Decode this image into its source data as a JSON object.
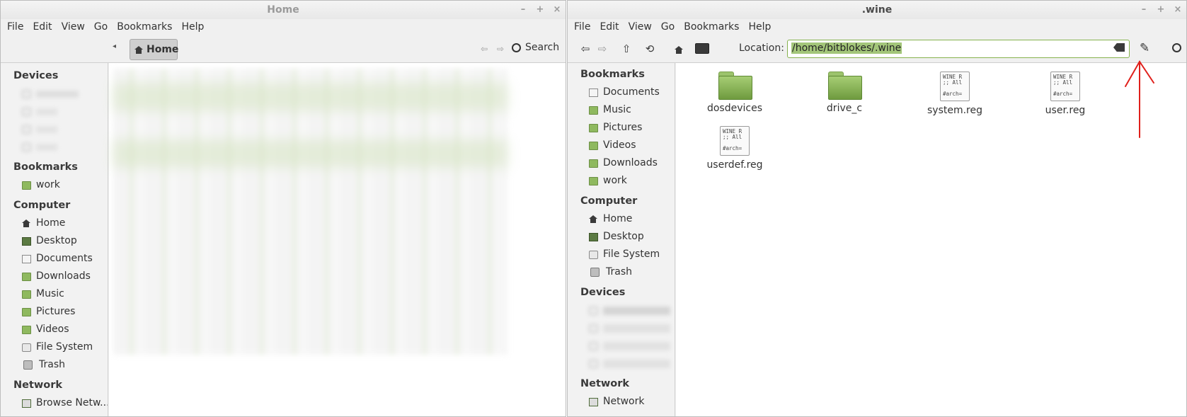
{
  "left_window": {
    "title": "Home",
    "menu": [
      "File",
      "Edit",
      "View",
      "Go",
      "Bookmarks",
      "Help"
    ],
    "toolbar": {
      "crumb": "Home",
      "search_label": "Search"
    },
    "sidebar": {
      "devices_heading": "Devices",
      "bookmarks_heading": "Bookmarks",
      "bookmarks": [
        "work"
      ],
      "computer_heading": "Computer",
      "computer": [
        "Home",
        "Desktop",
        "Documents",
        "Downloads",
        "Music",
        "Pictures",
        "Videos",
        "File System",
        "Trash"
      ],
      "network_heading": "Network",
      "network": [
        "Browse Netw..."
      ]
    }
  },
  "right_window": {
    "title": ".wine",
    "menu": [
      "File",
      "Edit",
      "View",
      "Go",
      "Bookmarks",
      "Help"
    ],
    "toolbar": {
      "location_label": "Location:",
      "location_value": "/home/bitblokes/.wine"
    },
    "sidebar": {
      "bookmarks_heading": "Bookmarks",
      "bookmarks": [
        "Documents",
        "Music",
        "Pictures",
        "Videos",
        "Downloads",
        "work"
      ],
      "computer_heading": "Computer",
      "computer": [
        "Home",
        "Desktop",
        "File System",
        "Trash"
      ],
      "devices_heading": "Devices",
      "network_heading": "Network",
      "network": [
        "Network"
      ]
    },
    "files": [
      {
        "name": "dosdevices",
        "kind": "folder"
      },
      {
        "name": "drive_c",
        "kind": "folder"
      },
      {
        "name": "system.reg",
        "kind": "reg",
        "preview": "WINE R\n;; All\n\n#arch="
      },
      {
        "name": "user.reg",
        "kind": "reg",
        "preview": "WINE R\n;; All\n\n#arch="
      },
      {
        "name": "userdef.reg",
        "kind": "reg",
        "preview": "WINE R\n;; All\n\n#arch="
      }
    ]
  },
  "annotation": {
    "color": "#e0201b"
  }
}
